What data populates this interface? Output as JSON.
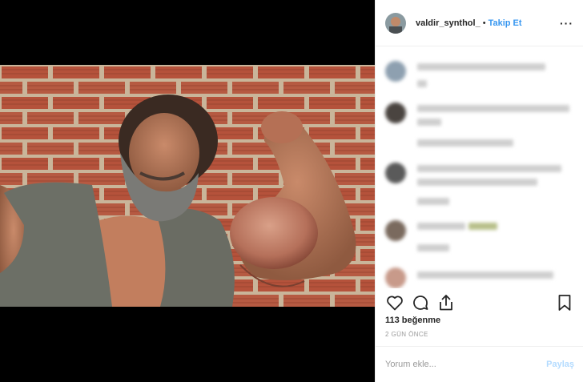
{
  "post": {
    "username": "valdir_synthol_",
    "separator": "•",
    "follow_label": "Takip Et",
    "more_label": "···",
    "likes": "113 beğenme",
    "timestamp": "2 GÜN ÖNCE",
    "comment_placeholder": "Yorum ekle...",
    "post_label": "Paylaş"
  },
  "colors": {
    "accent": "#3897f0",
    "accent_disabled": "#b3dbff",
    "brick": "#b5523b",
    "mortar": "#c9b59a"
  },
  "icons": {
    "like": "heart-icon",
    "comment": "comment-icon",
    "share": "share-icon",
    "save": "bookmark-icon",
    "more": "more-icon"
  }
}
